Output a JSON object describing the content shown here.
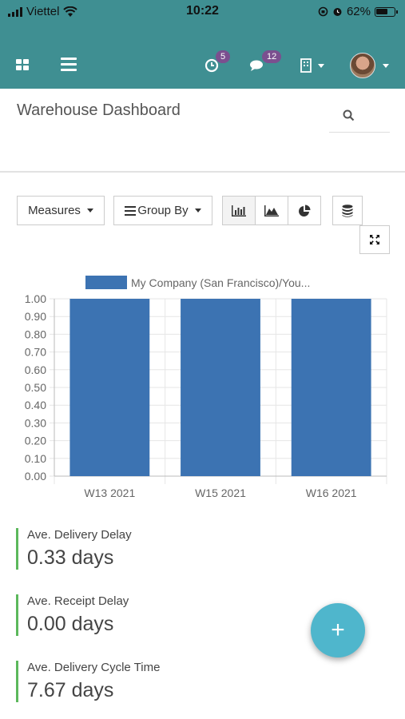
{
  "status_bar": {
    "carrier": "Viettel",
    "time": "10:22",
    "battery": "62%"
  },
  "navbar": {
    "activity_count": "5",
    "messages_count": "12"
  },
  "header": {
    "title": "Warehouse Dashboard"
  },
  "toolbar": {
    "measures_label": "Measures",
    "group_by_label": "Group By"
  },
  "chart_data": {
    "type": "bar",
    "categories": [
      "W13 2021",
      "W15 2021",
      "W16 2021"
    ],
    "series": [
      {
        "name": "My Company (San Francisco)/You...",
        "values": [
          1.0,
          1.0,
          1.0
        ],
        "color": "#3c73b2"
      }
    ],
    "yticks": [
      "0.00",
      "0.10",
      "0.20",
      "0.30",
      "0.40",
      "0.50",
      "0.60",
      "0.70",
      "0.80",
      "0.90",
      "1.00"
    ],
    "ylim": [
      0,
      1.0
    ],
    "legend": "top-center",
    "grid": true
  },
  "kpis": [
    {
      "label": "Ave. Delivery Delay",
      "value": "0.33 days"
    },
    {
      "label": "Ave. Receipt Delay",
      "value": "0.00 days"
    },
    {
      "label": "Ave. Delivery Cycle Time",
      "value": "7.67 days"
    }
  ],
  "fab": {
    "label": "+"
  },
  "colors": {
    "navbar": "#3f8f92",
    "kpi_border": "#5cb85c",
    "fab": "#4fb6cc",
    "badge": "#7b4f8f"
  }
}
